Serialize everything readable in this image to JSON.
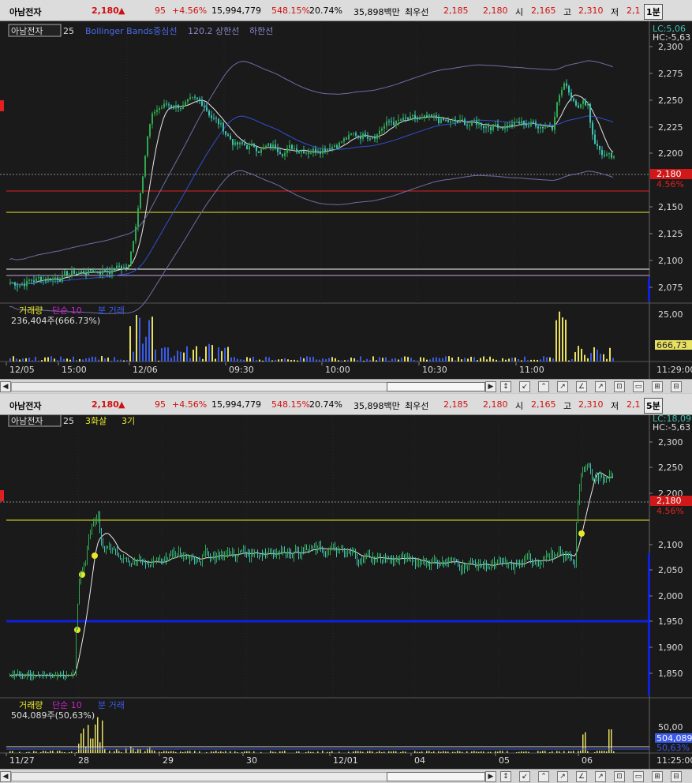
{
  "quote": {
    "name": "아남전자",
    "price": "2,180",
    "arrow": "▲",
    "change": "95",
    "pct": "+4.56%",
    "volume": "15,994,779",
    "volratio": "548.15%",
    "turnover": "20.74%",
    "amount": "35,898백만",
    "prio_label": "최우선",
    "bid": "2,185",
    "ask": "2,180",
    "open_label": "시",
    "open": "2,165",
    "high_label": "고",
    "high": "2,310",
    "low_label": "저",
    "low": "2,1"
  },
  "chart1": {
    "period": "1분",
    "symbol": "아남전자",
    "count": "25",
    "ind": "Bollinger Bands중심선",
    "ind_val": "120.2",
    "upper": "상한선",
    "lower": "하한선",
    "lc": "LC:5,06",
    "hc": "HC:-5,63",
    "price_ticks": [
      "2,300",
      "2,275",
      "2,250",
      "2,225",
      "2,200",
      "2,150",
      "2,125",
      "2,100",
      "2,075"
    ],
    "last": "2,180",
    "last_pct": "4.56%",
    "vol_label": "거래량",
    "vol_ma": "단순 10",
    "vol_ind": "분 거래",
    "vol_text": "236,404주(666.73%)",
    "vol_ticks": [
      "25,00",
      "666,73"
    ],
    "time_ticks": [
      "12/05",
      "15:00",
      "12/06",
      "09:30",
      "10:00",
      "10:30",
      "11:00"
    ],
    "time_end": "11:29:00",
    "icons": [
      "↕",
      "↙",
      "⌃",
      "↗",
      "∠",
      "↗",
      "⊡",
      "▭",
      "⊞",
      "⊟"
    ]
  },
  "chart2": {
    "period": "5분",
    "symbol": "아남전자",
    "count": "25",
    "ind": "3화살",
    "ind2": "3기",
    "lc": "LC:18,09",
    "hc": "HC:-5,63",
    "price_ticks": [
      "2,300",
      "2,250",
      "2,200",
      "2,100",
      "2,050",
      "2,000",
      "1,950",
      "1,900",
      "1,850"
    ],
    "last": "2,180",
    "last_pct": "4.56%",
    "vol_label": "거래량",
    "vol_ma": "단순 10",
    "vol_ind": "분 거래",
    "vol_text": "504,089주(50,63%)",
    "vol_ticks": [
      "50,00",
      "504,089",
      "50,63%"
    ],
    "time_ticks": [
      "11/27",
      "28",
      "29",
      "30",
      "12/01",
      "04",
      "05",
      "06"
    ],
    "time_end": "11:25:00",
    "icons": [
      "↕",
      "↙",
      "⌃",
      "↗",
      "∠",
      "↗",
      "⊡",
      "▭",
      "⊞",
      "⊟"
    ]
  },
  "colors": {
    "up": "#3ec0b0",
    "upb": "#2fa84f",
    "ma": "#e8e8e8",
    "bb": "#6e6ea8",
    "mid": "#3050d0",
    "red": "#e02020",
    "yellow": "#e8e82a",
    "blue": "#1020e0",
    "pink": "#d020d0",
    "volblue": "#3a5ae8",
    "volyellow": "#e8e060"
  }
}
